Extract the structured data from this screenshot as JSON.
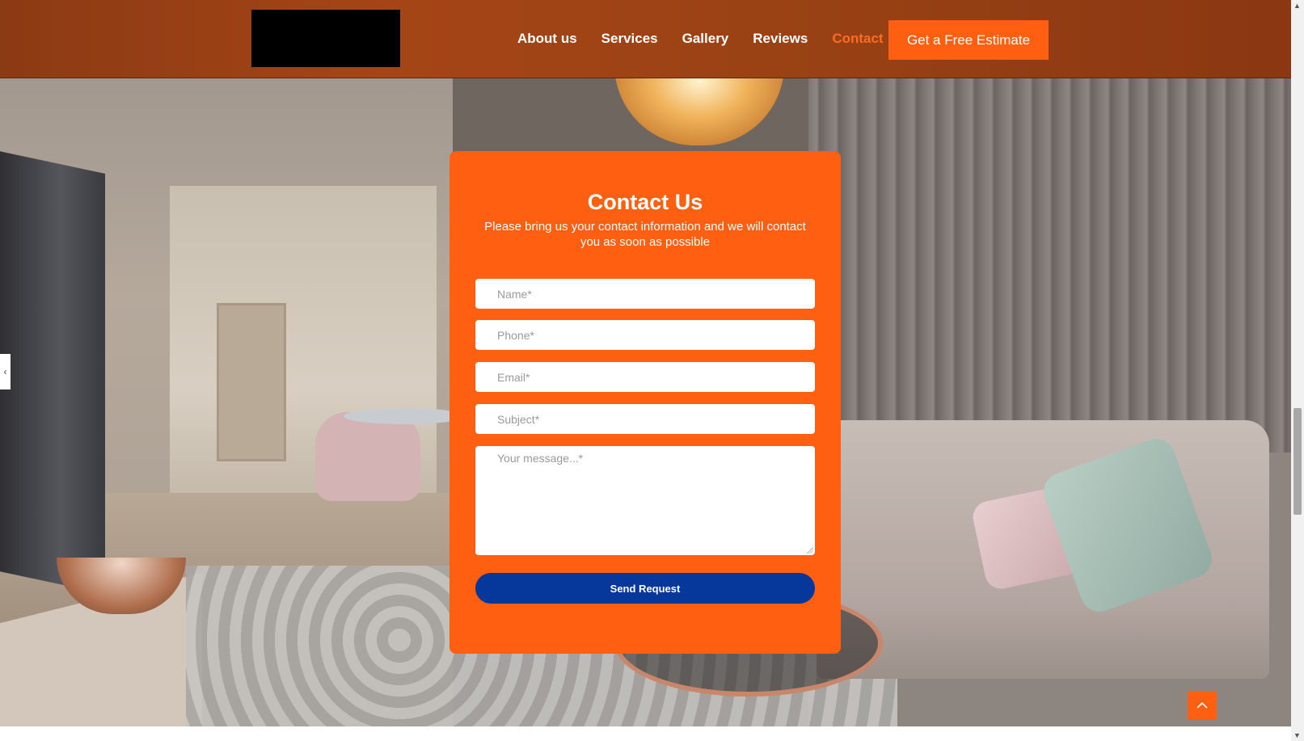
{
  "header": {
    "logo_alt": "",
    "nav": [
      {
        "label": "About us",
        "active": false
      },
      {
        "label": "Services",
        "active": false
      },
      {
        "label": "Gallery",
        "active": false
      },
      {
        "label": "Reviews",
        "active": false
      },
      {
        "label": "Contact",
        "active": true
      }
    ],
    "cta_label": "Get a Free Estimate"
  },
  "contact": {
    "title": "Contact Us",
    "subtitle": "Please bring us your contact information and we will contact you as soon as possible",
    "fields": {
      "name_placeholder": "Name*",
      "phone_placeholder": "Phone*",
      "email_placeholder": "Email*",
      "subject_placeholder": "Subject*",
      "message_placeholder": "Your message...*"
    },
    "submit_label": "Send Request"
  },
  "side_tab": {
    "glyph": "‹"
  },
  "colors": {
    "accent": "#ff5f10",
    "header": "#9a4214",
    "button_primary": "#06379a",
    "active_nav": "#ff6b1f"
  },
  "icons": {
    "to_top": "chevron-up-icon",
    "side_tab": "chevron-left-icon"
  }
}
